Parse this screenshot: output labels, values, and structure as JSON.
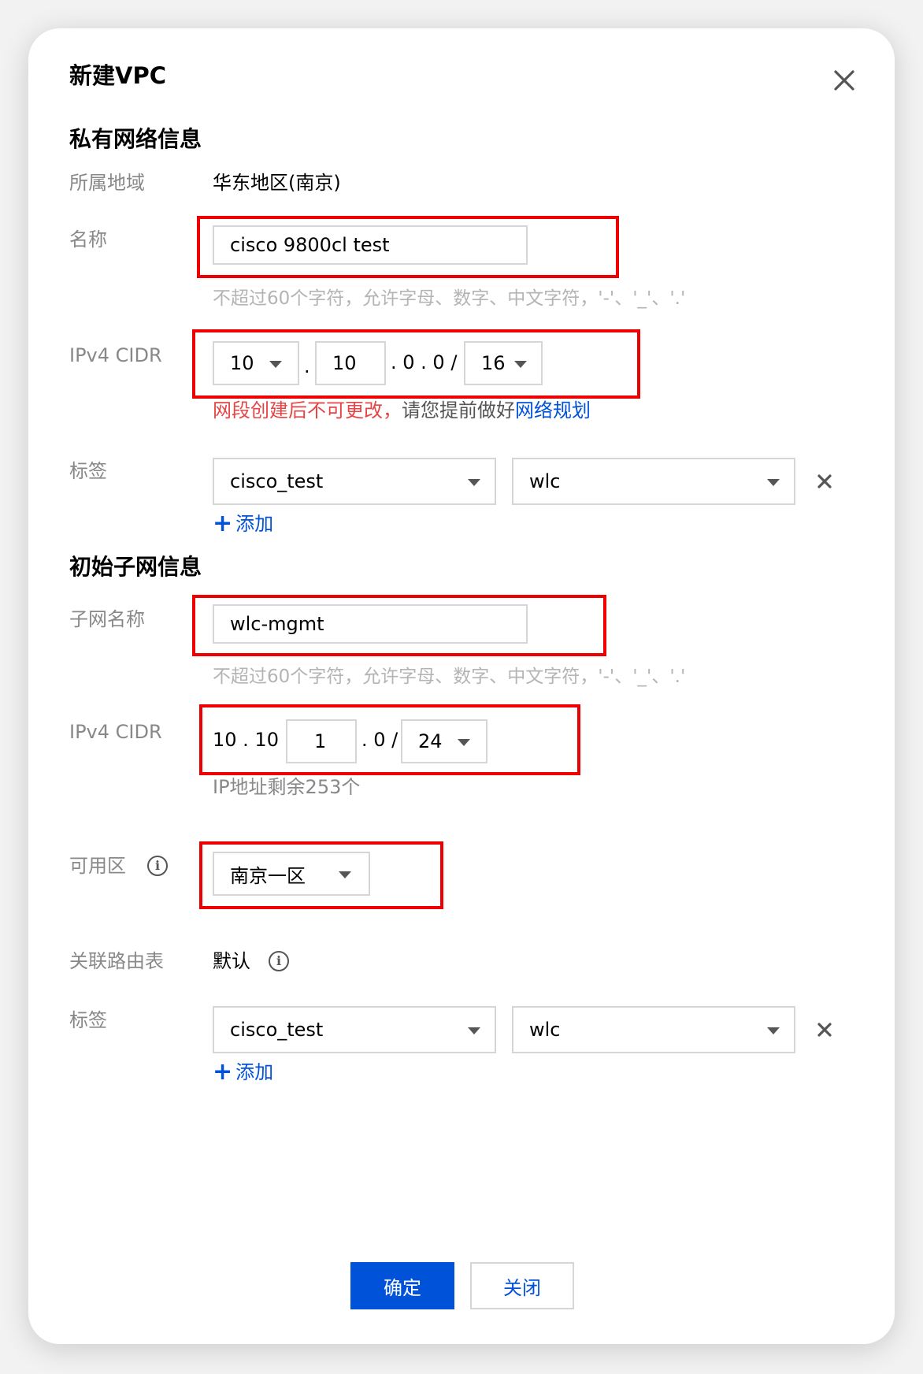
{
  "dialog": {
    "title": "新建VPC",
    "close_icon": "close-icon"
  },
  "vpc": {
    "section_title": "私有网络信息",
    "region_label": "所属地域",
    "region_value": "华东地区(南京)",
    "name_label": "名称",
    "name_value": "cisco 9800cl test",
    "name_hint": "不超过60个字符，允许字母、数字、中文字符，'-'、'_'、'.'",
    "cidr_label": "IPv4 CIDR",
    "cidr_octet1": "10",
    "cidr_dot1": ".",
    "cidr_octet2": "10",
    "cidr_suffix": ". 0 . 0 /",
    "cidr_mask": "16",
    "cidr_warning": "网段创建后不可更改，",
    "cidr_tip": "请您提前做好",
    "cidr_link": "网络规划",
    "tag_label": "标签",
    "tag_key": "cisco_test",
    "tag_value": "wlc",
    "add_label": "添加"
  },
  "subnet": {
    "section_title": "初始子网信息",
    "name_label": "子网名称",
    "name_value": "wlc-mgmt",
    "name_hint": "不超过60个字符，允许字母、数字、中文字符，'-'、'_'、'.'",
    "cidr_label": "IPv4 CIDR",
    "cidr_prefix": "10 . 10 .",
    "cidr_octet3": "1",
    "cidr_suffix": ". 0 /",
    "cidr_mask": "24",
    "ip_remaining": "IP地址剩余253个",
    "zone_label": "可用区",
    "zone_value": "南京一区",
    "route_label": "关联路由表",
    "route_value": "默认",
    "tag_label": "标签",
    "tag_key": "cisco_test",
    "tag_value": "wlc",
    "add_label": "添加"
  },
  "footer": {
    "confirm_label": "确定",
    "close_label": "关闭"
  },
  "colors": {
    "primary": "#0052d9",
    "highlight": "#ef0000",
    "warning_text": "#e54545",
    "link": "#0052d9"
  }
}
